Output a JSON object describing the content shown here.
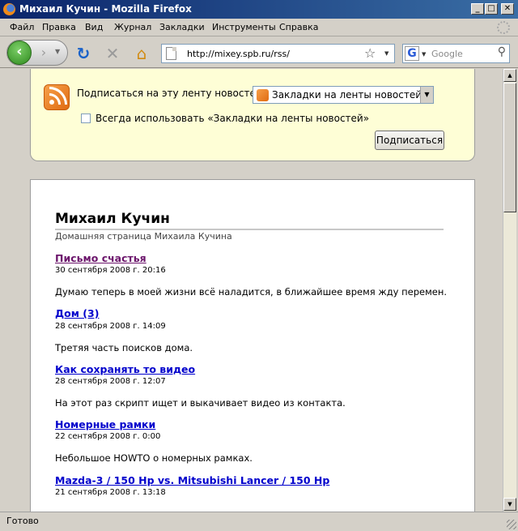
{
  "window": {
    "title": "Михаил Кучин - Mozilla Firefox"
  },
  "menu": {
    "items": [
      "Файл",
      "Правка",
      "Вид",
      "Журнал",
      "Закладки",
      "Инструменты",
      "Справка"
    ]
  },
  "navigation": {
    "url": "http://mixey.spb.ru/rss/",
    "search_placeholder": "Google"
  },
  "subscribe": {
    "label": "Подписаться на эту ленту новостей",
    "reader_selected": "Закладки на ленты новостей",
    "always_use_label": "Всегда использовать «Закладки на ленты новостей»",
    "always_use_checked": false,
    "button_label": "Подписаться"
  },
  "feed": {
    "title": "Михаил Кучин",
    "subtitle": "Домашняя страница Михаила Кучина",
    "entries": [
      {
        "title": "Письмо счастья",
        "date": "30 сентября 2008 г. 20:16",
        "text": "Думаю теперь в моей жизни всё наладится, в ближайшее время жду перемен.",
        "visited": true
      },
      {
        "title": "Дом (3)",
        "date": "28 сентября 2008 г. 14:09",
        "text": "Третяя часть поисков дома.",
        "visited": false
      },
      {
        "title": "Как сохранять то видео",
        "date": "28 сентября 2008 г. 12:07",
        "text": "На этот раз скрипт ищет и выкачивает видео из контакта.",
        "visited": false
      },
      {
        "title": "Номерные рамки",
        "date": "22 сентября 2008 г. 0:00",
        "text": "Небольшое HOWTO о номерных рамках.",
        "visited": false
      },
      {
        "title": "Mazda-3 / 150 Hp vs. Mitsubishi Lancer / 150 Hp",
        "date": "21 сентября 2008 г. 13:18",
        "text": "",
        "visited": false
      }
    ]
  },
  "status": {
    "text": "Готово"
  }
}
